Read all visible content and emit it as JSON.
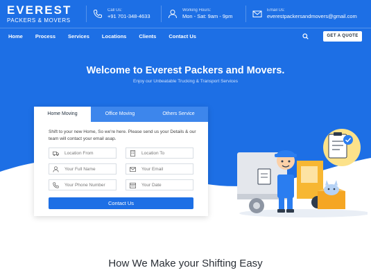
{
  "brand": {
    "name": "EVEREST",
    "tagline": "PACKERS & MOVERS"
  },
  "contacts": {
    "call": {
      "label": "Call Us:",
      "value": "+91 701-348-4633"
    },
    "hours": {
      "label": "Working Hours:",
      "value": "Mon - Sat: 9am - 9pm"
    },
    "email": {
      "label": "Email Us:",
      "value": "everestpackersandmovers@gmail.com"
    }
  },
  "nav": {
    "items": [
      "Home",
      "Process",
      "Services",
      "Locations",
      "Clients",
      "Contact Us"
    ]
  },
  "header": {
    "quote_label": "GET A QUOTE"
  },
  "hero": {
    "title": "Welcome to Everest Packers and Movers.",
    "subtitle": "Enjoy our Unbeatable Trucking & Transport Services"
  },
  "form": {
    "tabs": [
      "Home Moving",
      "Office Moving",
      "Others Service"
    ],
    "active_tab": "Home Moving",
    "description": "Shift to your new Home, So we're here. Please send us your Details & our team will contact your email asap.",
    "fields": {
      "location_from": "Location From",
      "location_to": "Location To",
      "full_name": "Your Full Name",
      "email": "Your Email",
      "phone": "Your Phone Number",
      "date": "Your Date"
    },
    "submit_label": "Contact Us"
  },
  "section": {
    "title": "How We Make your Shifting Easy"
  },
  "colors": {
    "brand_blue": "#1d6fe5",
    "tab_blue": "#3d86ec",
    "white": "#ffffff"
  }
}
